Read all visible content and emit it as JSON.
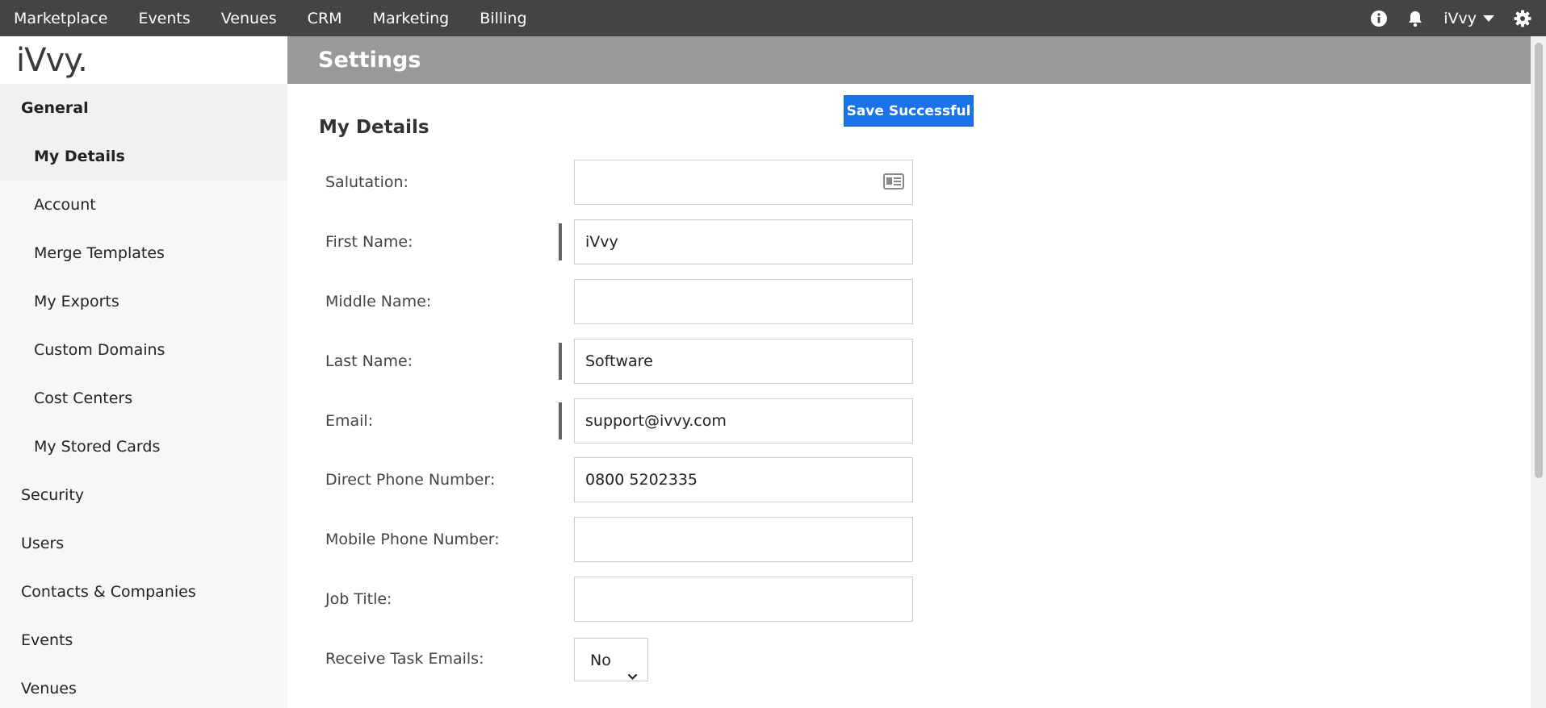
{
  "topnav": {
    "items": [
      "Marketplace",
      "Events",
      "Venues",
      "CRM",
      "Marketing",
      "Billing"
    ],
    "user_label": "iVvy"
  },
  "sidebar": {
    "logo": "iVvy.",
    "group_label": "General",
    "sub_items": [
      "My Details",
      "Account",
      "Merge Templates",
      "My Exports",
      "Custom Domains",
      "Cost Centers",
      "My Stored Cards"
    ],
    "items": [
      "Security",
      "Users",
      "Contacts & Companies",
      "Events",
      "Venues"
    ]
  },
  "page": {
    "title": "Settings",
    "toast": "Save Successful",
    "section_title": "My Details"
  },
  "form": {
    "salutation": {
      "label": "Salutation:",
      "value": ""
    },
    "first_name": {
      "label": "First Name:",
      "value": "iVvy"
    },
    "middle_name": {
      "label": "Middle Name:",
      "value": ""
    },
    "last_name": {
      "label": "Last Name:",
      "value": "Software"
    },
    "email": {
      "label": "Email:",
      "value": "support@ivvy.com"
    },
    "direct_phone": {
      "label": "Direct Phone Number:",
      "value": "0800 5202335"
    },
    "mobile_phone": {
      "label": "Mobile Phone Number:",
      "value": ""
    },
    "job_title": {
      "label": "Job Title:",
      "value": ""
    },
    "receive_task_emails": {
      "label": "Receive Task Emails:",
      "value": "No"
    }
  },
  "colors": {
    "topbar": "#444444",
    "header": "#999999",
    "toast": "#1a73e8"
  }
}
